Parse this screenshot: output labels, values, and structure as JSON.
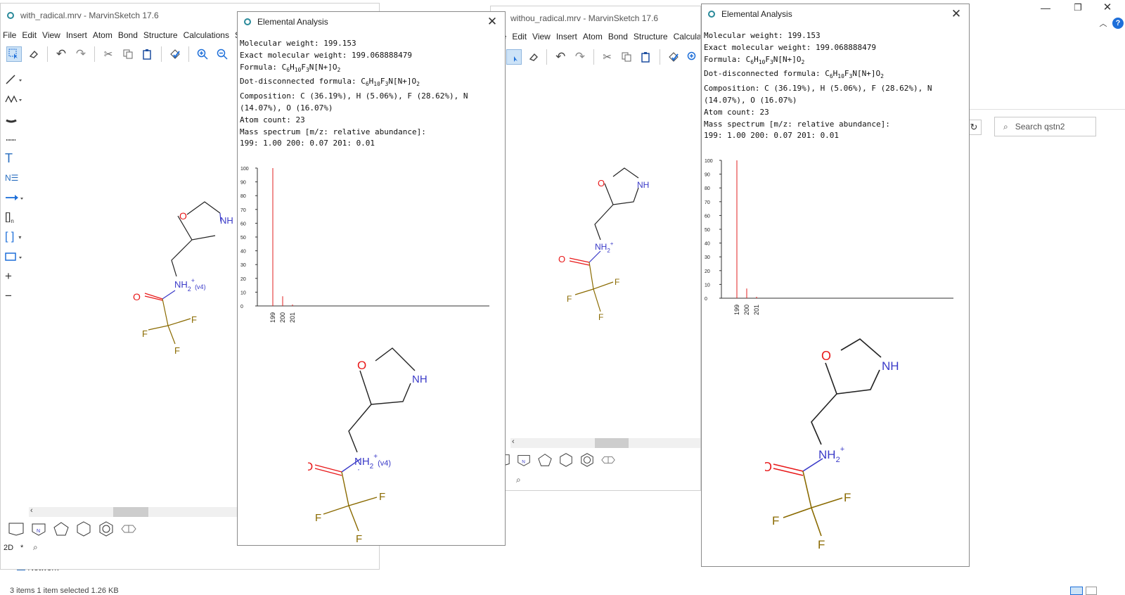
{
  "left_app": {
    "title": "with_radical.mrv - MarvinSketch 17.6",
    "menu": [
      "File",
      "Edit",
      "View",
      "Insert",
      "Atom",
      "Bond",
      "Structure",
      "Calculations",
      "S"
    ],
    "status_mode": "2D",
    "status_star": "*"
  },
  "mid_app": {
    "title": "withou_radical.mrv - MarvinSketch 17.6",
    "menu": [
      "File",
      "Edit",
      "View",
      "Insert",
      "Atom",
      "Bond",
      "Structure",
      "Calcula"
    ],
    "status_star": "*"
  },
  "explorer": {
    "search_placeholder": "Search qstn2",
    "network_label": "Network",
    "status_text": "3 items   1 item selected  1.26 KB"
  },
  "panel1": {
    "title": "Elemental Analysis",
    "close": "✕",
    "mw_label": "Molecular weight: ",
    "mw": "199.153",
    "emw_label": "Exact molecular weight: ",
    "emw": "199.068888479",
    "formula_label": "Formula: ",
    "ddf_label": "Dot-disconnected formula: ",
    "comp1": "Composition: C (36.19%), H (5.06%), F (28.62%), N",
    "comp2": "(14.07%), O (16.07%)",
    "atom_count": "Atom count: 23",
    "ms_label": "Mass spectrum [m/z: relative abundance]:",
    "ms_values": "199: 1.00 200: 0.07 201: 0.01"
  },
  "panel2": {
    "title": "Elemental Analysis",
    "close": "✕",
    "mw_label": "Molecular weight: ",
    "mw": "199.153",
    "emw_label": "Exact molecular weight: ",
    "emw": "199.068888479",
    "formula_label": "Formula: ",
    "ddf_label": "Dot-disconnected formula: ",
    "comp1": "Composition: C (36.19%), H (5.06%), F (28.62%), N",
    "comp2": "(14.07%), O (16.07%)",
    "atom_count": "Atom count: 23",
    "ms_label": "Mass spectrum [m/z: relative abundance]:",
    "ms_values": "199: 1.00 200: 0.07 201: 0.01"
  },
  "formula": {
    "c": "C",
    "c_n": "6",
    "h": "H",
    "h_n": "10",
    "f": "F",
    "f_n": "3",
    "rest": "N[N+]O",
    "o_n": "2"
  },
  "atoms": {
    "O": "O",
    "NH": "NH",
    "NH2": "NH",
    "two": "2",
    "plus": "+",
    "v4": "(v4)",
    "F": "F",
    "dot": "·"
  },
  "chart_data": [
    {
      "type": "bar",
      "title": "",
      "x": [
        199,
        200,
        201
      ],
      "values": [
        100,
        7,
        1
      ],
      "yticks": [
        0,
        10,
        20,
        30,
        40,
        50,
        60,
        70,
        80,
        90,
        100
      ],
      "ylim": [
        0,
        100
      ],
      "xlabel": "",
      "ylabel": "",
      "bar_color": "#e02020"
    },
    {
      "type": "bar",
      "title": "",
      "x": [
        199,
        200,
        201
      ],
      "values": [
        100,
        7,
        1
      ],
      "yticks": [
        0,
        10,
        20,
        30,
        40,
        50,
        60,
        70,
        80,
        90,
        100
      ],
      "ylim": [
        0,
        100
      ],
      "xlabel": "",
      "ylabel": "",
      "bar_color": "#e02020"
    }
  ],
  "colors": {
    "oxygen": "#e8191a",
    "nitrogen": "#3a3ac8",
    "fluorine": "#8a6a00",
    "accent": "#1e6fd9"
  }
}
